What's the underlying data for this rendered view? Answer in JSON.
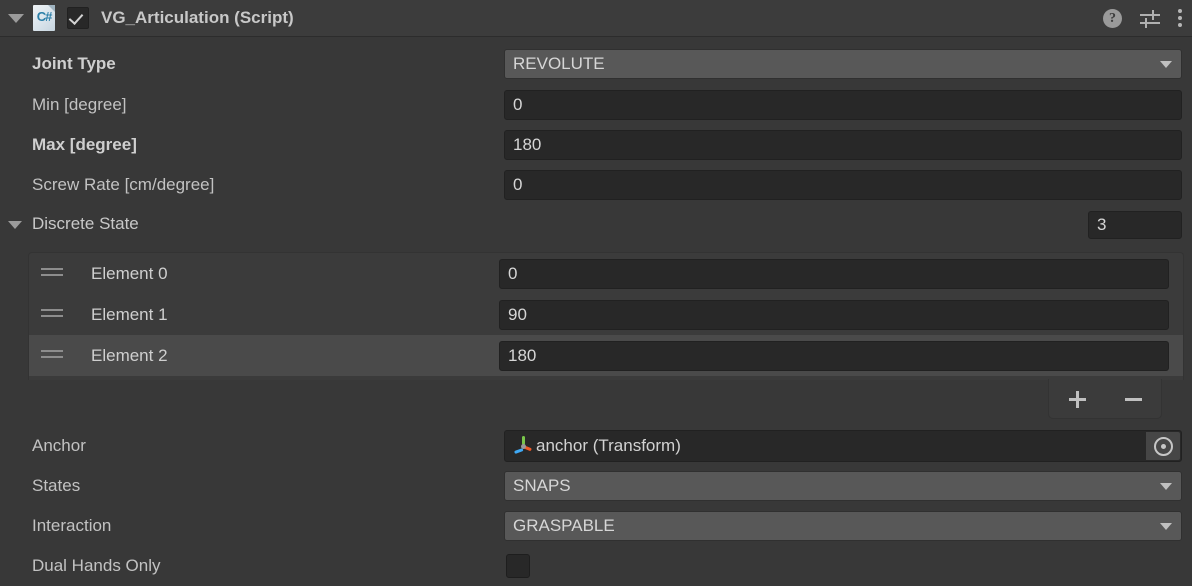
{
  "header": {
    "title": "VG_Articulation (Script)",
    "script_icon": "csharp-script-icon",
    "script_icon_text": "C#",
    "enabled": true,
    "foldout_expanded": true,
    "help_icon": "?",
    "preset_icon": "preset-sliders-icon",
    "menu_icon": "three-dot-menu-icon"
  },
  "properties": [
    {
      "label": "Joint Type",
      "bold": true,
      "type": "popup",
      "value": "REVOLUTE"
    },
    {
      "label": "Min [degree]",
      "bold": false,
      "type": "input",
      "value": "0"
    },
    {
      "label": "Max [degree]",
      "bold": true,
      "type": "input",
      "value": "180"
    },
    {
      "label": "Screw Rate [cm/degree]",
      "bold": false,
      "type": "input",
      "value": "0"
    }
  ],
  "discrete_state": {
    "label": "Discrete State",
    "expanded": true,
    "size": "3",
    "elements": [
      {
        "label": "Element 0",
        "value": "0",
        "selected": false
      },
      {
        "label": "Element 1",
        "value": "90",
        "selected": false
      },
      {
        "label": "Element 2",
        "value": "180",
        "selected": true
      }
    ],
    "add_button": "+",
    "remove_button": "-"
  },
  "bottom_properties": {
    "anchor": {
      "label": "Anchor",
      "value": "anchor (Transform)",
      "icon": "transform-gizmo-icon",
      "picker_icon": "object-picker-icon"
    },
    "states": {
      "label": "States",
      "value": "SNAPS"
    },
    "interaction": {
      "label": "Interaction",
      "value": "GRASPABLE"
    },
    "dual_hands_only": {
      "label": "Dual Hands Only",
      "checked": false
    }
  },
  "colors": {
    "background": "#383838",
    "header_background": "#3c3c3c",
    "input_background": "#282828",
    "popup_background": "#585858",
    "list_background": "#3b3b3b",
    "list_row_selected": "#4a4a4a",
    "text": "#c2c2c2",
    "axis_green": "#79c64b",
    "axis_red": "#f05a28",
    "axis_blue": "#3fa9f5"
  }
}
